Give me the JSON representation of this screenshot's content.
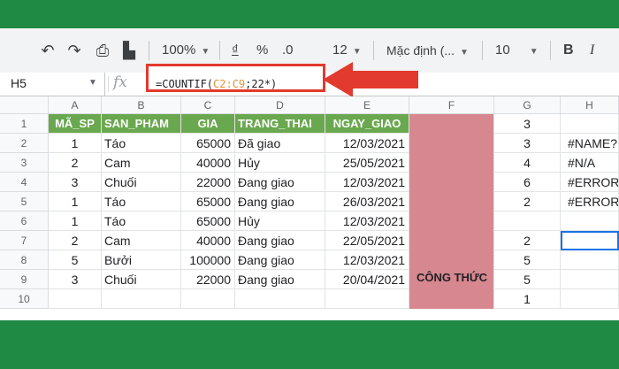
{
  "toolbar": {
    "zoom": "100%",
    "currency": "₫",
    "percent": "%",
    "decimal": ".0",
    "more_formats": "12",
    "font": "Mặc định (...",
    "font_size": "10",
    "bold": "B"
  },
  "formula_bar": {
    "cell_ref": "H5",
    "fx": "fx",
    "formula_prefix": "=COUNTIF(",
    "formula_range": "C2:C9",
    "formula_suffix": ";22*)"
  },
  "column_headers": [
    "A",
    "B",
    "C",
    "D",
    "E",
    "F",
    "G",
    "H"
  ],
  "row_headers": [
    "1",
    "2",
    "3",
    "4",
    "5",
    "6",
    "7",
    "8",
    "9",
    "10"
  ],
  "table_headers": [
    "MÃ_SP",
    "SAN_PHAM",
    "GIA",
    "TRANG_THAI",
    "NGAY_GIAO"
  ],
  "rows": [
    [
      "1",
      "Táo",
      "65000",
      "Đã giao",
      "12/03/2021"
    ],
    [
      "2",
      "Cam",
      "40000",
      "Hủy",
      "25/05/2021"
    ],
    [
      "3",
      "Chuối",
      "22000",
      "Đang giao",
      "12/03/2021"
    ],
    [
      "1",
      "Táo",
      "65000",
      "Đang giao",
      "26/03/2021"
    ],
    [
      "1",
      "Táo",
      "65000",
      "Hủy",
      "12/03/2021"
    ],
    [
      "2",
      "Cam",
      "40000",
      "Đang giao",
      "22/05/2021"
    ],
    [
      "5",
      "Bưởi",
      "100000",
      "Đang giao",
      "12/03/2021"
    ],
    [
      "3",
      "Chuối",
      "22000",
      "Đang giao",
      "20/04/2021"
    ]
  ],
  "col_f_label": "CÔNG THỨC",
  "col_g": [
    "3",
    "3",
    "4",
    "6",
    "2",
    "",
    "2",
    "5",
    "5",
    "1"
  ],
  "col_h": [
    "",
    "#NAME?",
    "#N/A",
    "#ERROR",
    "#ERROR",
    "",
    "",
    "",
    "",
    ""
  ],
  "colors": {
    "header_green": "#6aa84f",
    "formula_column": "#d7878f",
    "highlight_red": "#e23a2e",
    "selection_blue": "#1a73e8",
    "frame_green": "#1e8a44"
  }
}
